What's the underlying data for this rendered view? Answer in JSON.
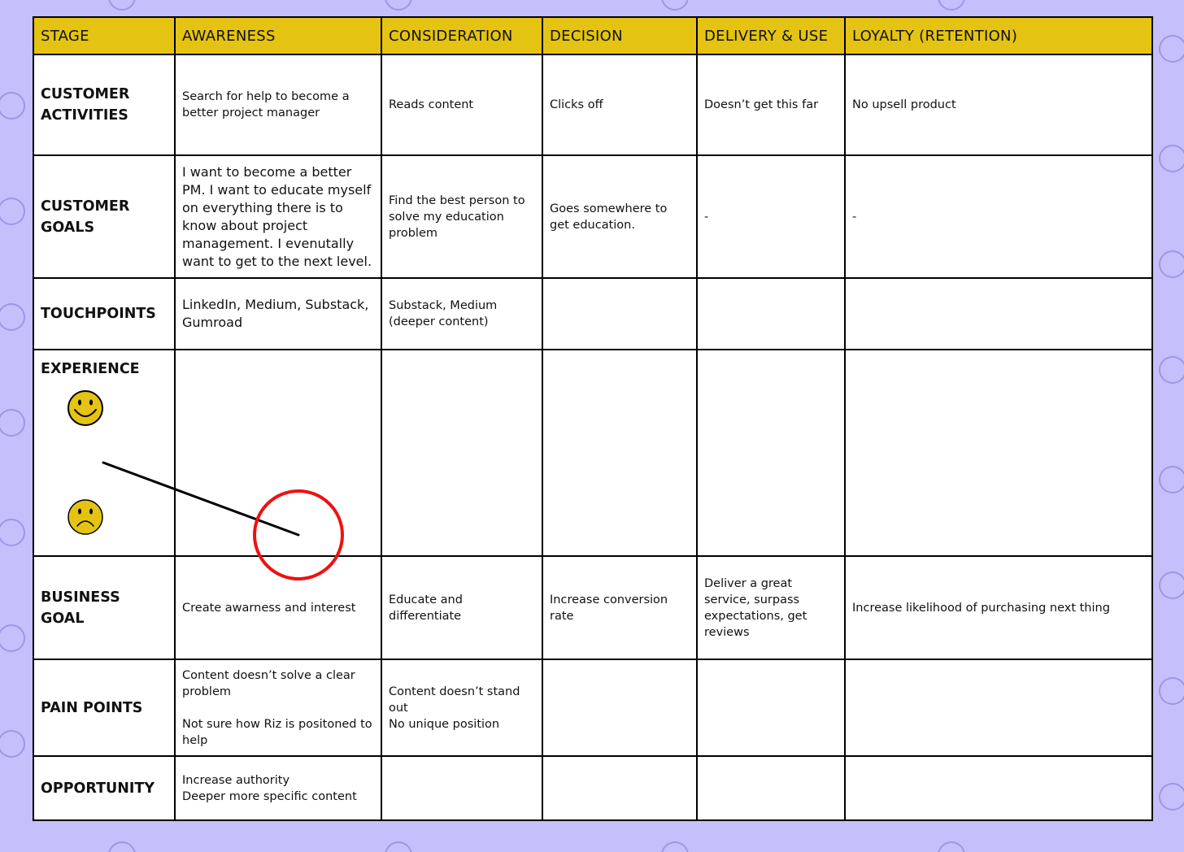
{
  "colors": {
    "background": "#c5bffb",
    "header_fill": "#e4c313",
    "grid": "#000000",
    "marker": "#ee1111",
    "emoji_fill": "#e4c313"
  },
  "header": {
    "stage": "STAGE",
    "stages": [
      "AWARENESS",
      "CONSIDERATION",
      "DECISION",
      "DELIVERY & USE",
      "LOYALTY (RETENTION)"
    ]
  },
  "rows": {
    "customer_activities": {
      "label": "CUSTOMER\nACTIVITIES",
      "cells": [
        "Search for help to become a better project manager",
        "Reads content",
        "Clicks off",
        "Doesn’t get this far",
        "No upsell product"
      ]
    },
    "customer_goals": {
      "label": "CUSTOMER\nGOALS",
      "cells": [
        "I want to become a better PM. I want to educate myself on everything there is to know about project management. I evenutally want to get to the next level.",
        "Find the best person to solve my education problem",
        "Goes somewhere to get education.",
        "-",
        "-"
      ]
    },
    "touchpoints": {
      "label": "TOUCHPOINTS",
      "cells": [
        "LinkedIn, Medium, Substack, Gumroad",
        "Substack, Medium (deeper content)",
        "",
        "",
        ""
      ]
    },
    "experience": {
      "label": "EXPERIENCE",
      "happy_icon": "smiley-face-icon",
      "sad_icon": "frowning-face-icon",
      "highlight_icon": "red-circle-marker"
    },
    "business_goal": {
      "label": "BUSINESS GOAL",
      "cells": [
        "Create awarness and interest",
        "Educate and differentiate",
        "Increase conversion rate",
        "Deliver a great service, surpass expectations, get reviews",
        "Increase likelihood of purchasing next thing"
      ]
    },
    "pain_points": {
      "label": "PAIN POINTS",
      "cells": [
        "Content doesn’t solve a clear problem\n\nNot sure how Riz is positoned to help",
        "Content doesn’t stand out\nNo unique position",
        "",
        "",
        ""
      ]
    },
    "opportunity": {
      "label": "OPPORTUNITY",
      "cells": [
        "Increase authority\nDeeper more specific content",
        "",
        "",
        "",
        ""
      ]
    }
  }
}
